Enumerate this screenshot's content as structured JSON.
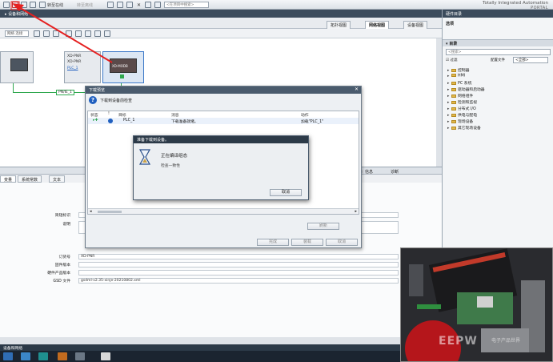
{
  "toolbar": {
    "go_online": "转至在线",
    "go_offline": "转至离线",
    "search_placeholder": "<在项目中搜索>",
    "brand_line1": "Totally Integrated Automation",
    "brand_line2": "PORTAL"
  },
  "breadcrumb": "▸ 设备和网络",
  "view_tabs": [
    "拓扑视图",
    "网络视图",
    "设备视图"
  ],
  "editor": {
    "network_select": "网络 连接"
  },
  "canvas": {
    "device1_lines": [
      "XD-PNR",
      "XD-PNR",
      "PLC_1"
    ],
    "device2_name": "XD-MODB",
    "network_label": "PN/IE_1"
  },
  "catalog": {
    "header": "硬件目录",
    "options_label": "选项",
    "catalog_title": "▾ 目录",
    "search_placeholder": "<搜索>",
    "filter_label": "过滤",
    "profile_label": "配置文件",
    "profile_value": "<全部>",
    "items": [
      "控制器",
      "HMI",
      "PC 系统",
      "驱动器和启动器",
      "网络组件",
      "检测和监视",
      "分布式 I/O",
      "供电与配电",
      "现场设备",
      "其它现场设备"
    ]
  },
  "inspector": {
    "info_tab": "信息",
    "diag_tab": "诊断",
    "sub_tabs": [
      "变量",
      "系统常数",
      "文本"
    ],
    "rows": [
      {
        "label": "简短标识",
        "value": ""
      },
      {
        "label": "说明",
        "value": ""
      },
      {
        "label": "订货号",
        "value": "XD-PNR"
      },
      {
        "label": "固件版本",
        "value": ""
      },
      {
        "label": "硬件产品版本",
        "value": ""
      },
      {
        "label": "GSD 文件",
        "value": "gsdml-v2.35-xinje-20210802.xml"
      }
    ]
  },
  "download_dialog": {
    "title": "下载预览",
    "message": "下载到设备前检查",
    "columns": [
      "状态",
      "!",
      "目标",
      "消息",
      "动作"
    ],
    "row": {
      "target": "PLC_1",
      "message": "下载准备就绪。",
      "action": "加载\"PLC_1\""
    },
    "buttons": [
      "刷新",
      "完成",
      "装载",
      "取消"
    ]
  },
  "progress_dialog": {
    "title": "准备下载到设备。",
    "main": "正在编译组态",
    "sub": "检查一致性",
    "cancel": "取消"
  },
  "portal": {
    "label": "设备和网络"
  },
  "watermark": {
    "logo": "EEPW",
    "sub": "电子产品世界"
  },
  "colors": {
    "accent_red": "#e52020",
    "network_green": "#2fa84f",
    "header_dark": "#3b4b5c"
  }
}
